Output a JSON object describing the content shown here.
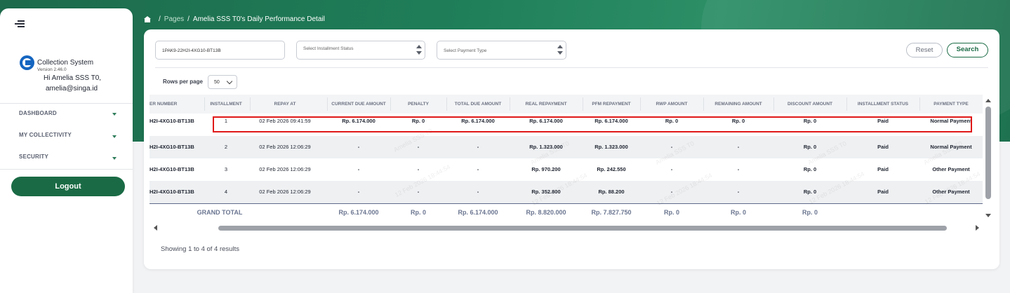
{
  "sidebar": {
    "app_name": "Collection System",
    "version": "Version 2.46.0",
    "greeting": "Hi Amelia SSS T0,",
    "email": "amelia@singa.id",
    "nav": [
      {
        "label": "DASHBOARD"
      },
      {
        "label": "MY COLLECTIVITY"
      },
      {
        "label": "SECURITY"
      }
    ],
    "logout_label": "Logout"
  },
  "breadcrumb": {
    "sep": "/",
    "pages": "Pages",
    "current": "Amelia SSS T0's Daily Performance Detail"
  },
  "filters": {
    "loan_id_value": "1PAK9-22H2I-4XG10-BT13B",
    "installment_status_placeholder": "Select Installment Status",
    "payment_type_placeholder": "Select Payment Type",
    "reset_label": "Reset",
    "search_label": "Search"
  },
  "rows_per_page": {
    "label": "Rows per page",
    "value": "50"
  },
  "table": {
    "headers": [
      "ER NUMBER",
      "INSTALLMENT",
      "REPAY AT",
      "CURRENT DUE AMOUNT",
      "PENALTY",
      "TOTAL DUE AMOUNT",
      "REAL REPAYMENT",
      "PFM REPAYMENT",
      "RWP AMOUNT",
      "REMAINING AMOUNT",
      "DISCOUNT AMOUNT",
      "INSTALLMENT STATUS",
      "PAYMENT TYPE"
    ],
    "rows": [
      {
        "loan": "H2I-4XG10-BT13B",
        "installment": "1",
        "repay_at": "02 Feb 2026 09:41:59",
        "current_due": "Rp. 6.174.000",
        "penalty": "Rp. 0",
        "total_due": "Rp. 6.174.000",
        "real_repayment": "Rp. 6.174.000",
        "pfm_repayment": "Rp. 6.174.000",
        "rwp": "Rp. 0",
        "remaining": "Rp. 0",
        "discount": "Rp. 0",
        "status": "Paid",
        "payment_type": "Normal Payment"
      },
      {
        "loan": "H2I-4XG10-BT13B",
        "installment": "2",
        "repay_at": "02 Feb 2026 12:06:29",
        "current_due": "-",
        "penalty": "-",
        "total_due": "-",
        "real_repayment": "Rp. 1.323.000",
        "pfm_repayment": "Rp. 1.323.000",
        "rwp": "-",
        "remaining": "-",
        "discount": "Rp. 0",
        "status": "Paid",
        "payment_type": "Normal Payment"
      },
      {
        "loan": "H2I-4XG10-BT13B",
        "installment": "3",
        "repay_at": "02 Feb 2026 12:06:29",
        "current_due": "-",
        "penalty": "-",
        "total_due": "-",
        "real_repayment": "Rp. 970.200",
        "pfm_repayment": "Rp. 242.550",
        "rwp": "-",
        "remaining": "-",
        "discount": "Rp. 0",
        "status": "Paid",
        "payment_type": "Other Payment"
      },
      {
        "loan": "H2I-4XG10-BT13B",
        "installment": "4",
        "repay_at": "02 Feb 2026 12:06:29",
        "current_due": "-",
        "penalty": "-",
        "total_due": "-",
        "real_repayment": "Rp. 352.800",
        "pfm_repayment": "Rp. 88.200",
        "rwp": "-",
        "remaining": "-",
        "discount": "Rp. 0",
        "status": "Paid",
        "payment_type": "Other Payment"
      }
    ],
    "total": {
      "label": "GRAND TOTAL",
      "current_due": "Rp. 6.174.000",
      "penalty": "Rp. 0",
      "total_due": "Rp. 6.174.000",
      "real_repayment": "Rp. 8.820.000",
      "pfm_repayment": "Rp. 7.827.750",
      "rwp": "Rp. 0",
      "remaining": "Rp. 0",
      "discount": "Rp. 0"
    },
    "watermark_lines": [
      "Amelia SSS T0",
      "12 Feb 2026 18:44:54"
    ]
  },
  "footer": {
    "showing": "Showing 1 to 4 of 4 results"
  },
  "colors": {
    "brand_green": "#1a6b45",
    "highlight": "#e01818",
    "header_gradient": "#1f7f59"
  },
  "icons": {
    "menu": "hamburger-icon",
    "home": "home-icon",
    "logo": "collection-system-logo"
  }
}
